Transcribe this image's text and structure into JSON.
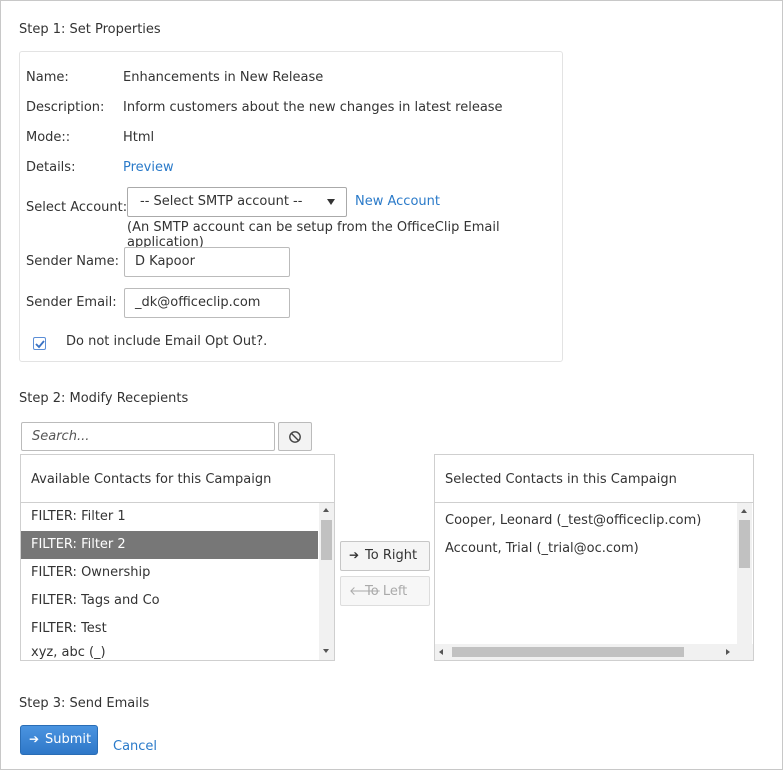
{
  "step1": {
    "title": "Step 1: Set Properties",
    "name_label": "Name:",
    "name_value": "Enhancements in New Release",
    "description_label": "Description:",
    "description_value": "Inform customers about the new changes in latest release",
    "mode_label": "Mode::",
    "mode_value": "Html",
    "details_label": "Details:",
    "details_link": "Preview",
    "account_label": "Select Account:",
    "account_selected": "-- Select SMTP account --",
    "new_account_link": "New Account",
    "account_note": "(An SMTP account can be setup from the OfficeClip Email application)",
    "sender_name_label": "Sender Name:",
    "sender_name_value": "D Kapoor",
    "sender_email_label": "Sender Email:",
    "sender_email_value": "_dk@officeclip.com",
    "optout_label": "Do not include Email Opt Out?.",
    "optout_checked": true
  },
  "step2": {
    "title": "Step 2: Modify Recepients",
    "search_placeholder": "Search...",
    "available_header": "Available Contacts for this Campaign",
    "available_items": [
      "FILTER: Filter 1",
      "FILTER: Filter 2",
      "FILTER: Ownership",
      "FILTER: Tags and Co",
      "FILTER: Test",
      "xyz, abc (_)"
    ],
    "selected_index": 1,
    "to_right_label": "To Right",
    "to_left_label": "To Left",
    "selected_header": "Selected Contacts in this Campaign",
    "selected_items": [
      "Cooper, Leonard (_test@officeclip.com)",
      "Account, Trial (_trial@oc.com)"
    ]
  },
  "step3": {
    "title": "Step 3: Send Emails",
    "submit_label": "Submit",
    "cancel_label": "Cancel"
  },
  "colors": {
    "link": "#2a7ac9",
    "selected_row": "#777777",
    "submit": "#2f78c8"
  }
}
